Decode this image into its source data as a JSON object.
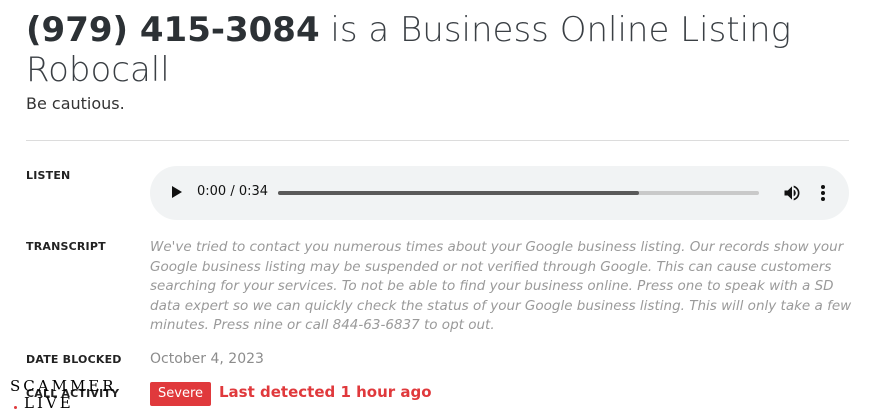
{
  "header": {
    "phone_number": "(979) 415-3084",
    "title_rest": " is a Business Online Listing Robocall",
    "subtitle": "Be cautious."
  },
  "labels": {
    "listen": "LISTEN",
    "transcript": "TRANSCRIPT",
    "date_blocked": "DATE BLOCKED",
    "call_activity": "CALL ACTIVITY"
  },
  "audio": {
    "time": "0:00 / 0:34",
    "buffered_fraction": 0.75,
    "icons": {
      "play": "play-icon",
      "volume": "volume-icon",
      "more": "more-vertical-icon"
    }
  },
  "transcript": "We've tried to contact you numerous times about your Google business listing. Our records show your Google business listing may be suspended or not verified through Google. This can cause customers searching for your services. To not be able to find your business online. Press one to speak with a SD data expert so we can quickly check the status of your Google business listing. This will only take a few minutes. Press nine or call 844-63-6837 to opt out.",
  "date_blocked": "October 4, 2023",
  "call_activity": {
    "severity": "Severe",
    "last_detected": "Last detected 1 hour ago",
    "severity_color": "#e0393c"
  },
  "watermark": {
    "line1": "SCAMMER",
    "line2": "LIVE"
  }
}
